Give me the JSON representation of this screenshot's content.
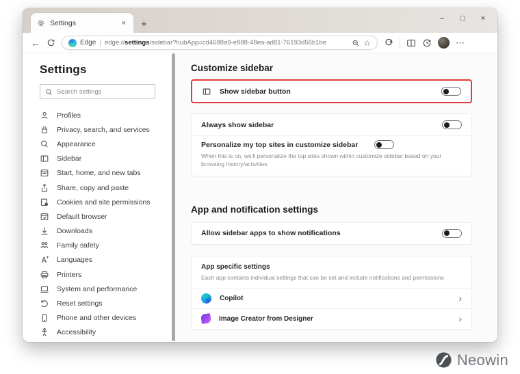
{
  "colors": {
    "highlight_red": "#dd3c38",
    "copilot_blue": "#1b63e8",
    "image_creator_purple": "#a34af2",
    "tabbar_beige": "#d7d0c8"
  },
  "glyphs": {
    "close_tab": "×",
    "new_tab": "+",
    "minimize": "–",
    "maximize": "□",
    "close": "×",
    "back": "←",
    "pipe": "|",
    "star": "☆",
    "more": "⋯",
    "chevron": "›"
  },
  "tab": {
    "title": "Settings"
  },
  "address": {
    "site_label": "Edge",
    "url_prefix": "edge://",
    "url_bold": "settings",
    "url_rest": "/sidebar?hubApp=cd4688a9-e888-48ea-ad81-76193d56b1be"
  },
  "sidebar": {
    "title": "Settings",
    "search_placeholder": "Search settings",
    "items": [
      {
        "icon": "profiles-icon",
        "label": "Profiles"
      },
      {
        "icon": "privacy-icon",
        "label": "Privacy, search, and services"
      },
      {
        "icon": "appearance-icon",
        "label": "Appearance"
      },
      {
        "icon": "sidebar-icon",
        "label": "Sidebar"
      },
      {
        "icon": "start-home-tabs-icon",
        "label": "Start, home, and new tabs"
      },
      {
        "icon": "share-icon",
        "label": "Share, copy and paste"
      },
      {
        "icon": "cookies-icon",
        "label": "Cookies and site permissions"
      },
      {
        "icon": "default-browser-icon",
        "label": "Default browser"
      },
      {
        "icon": "downloads-icon",
        "label": "Downloads"
      },
      {
        "icon": "family-safety-icon",
        "label": "Family safety"
      },
      {
        "icon": "languages-icon",
        "label": "Languages"
      },
      {
        "icon": "printers-icon",
        "label": "Printers"
      },
      {
        "icon": "system-icon",
        "label": "System and performance"
      },
      {
        "icon": "reset-icon",
        "label": "Reset settings"
      },
      {
        "icon": "phone-icon",
        "label": "Phone and other devices"
      },
      {
        "icon": "accessibility-icon",
        "label": "Accessibility"
      }
    ]
  },
  "content": {
    "section1_title": "Customize sidebar",
    "show_sidebar_button": {
      "label": "Show sidebar button",
      "toggle_state": "off",
      "highlighted": true
    },
    "always_show_sidebar": {
      "label": "Always show sidebar",
      "toggle_state": "off"
    },
    "personalize_top_sites": {
      "label": "Personalize my top sites in customize sidebar",
      "toggle_state": "off",
      "description": "When this is on, we'll personalize the top sites shown within customize sidebar based on your browsing history/activities"
    },
    "section2_title": "App and notification settings",
    "allow_notifications": {
      "label": "Allow sidebar apps to show notifications",
      "toggle_state": "off"
    },
    "app_specific": {
      "title": "App specific settings",
      "description": "Each app contains individual settings that can be set and include notifications and permissions",
      "apps": [
        {
          "name": "Copilot"
        },
        {
          "name": "Image Creator from Designer"
        }
      ]
    }
  },
  "watermark": {
    "text": "Neowin"
  }
}
